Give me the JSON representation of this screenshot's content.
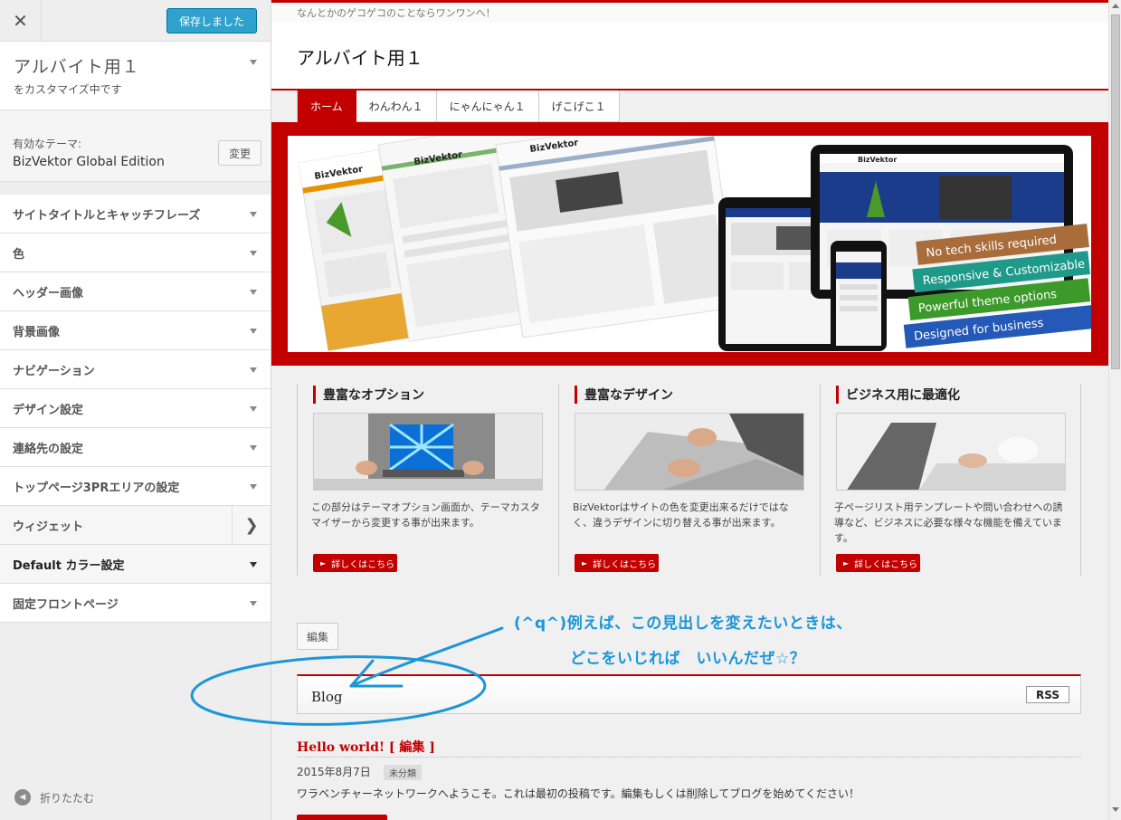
{
  "sidebar": {
    "close_glyph": "✕",
    "save_label": "保存しました",
    "site_title": "アルバイト用１",
    "site_subtitle": "をカスタマイズ中です",
    "theme_label": "有効なテーマ:",
    "theme_name": "BizVektor Global Edition",
    "theme_change": "変更",
    "sections": [
      {
        "label": "サイトタイトルとキャッチフレーズ"
      },
      {
        "label": "色"
      },
      {
        "label": "ヘッダー画像"
      },
      {
        "label": "背景画像"
      },
      {
        "label": "ナビゲーション"
      },
      {
        "label": "デザイン設定"
      },
      {
        "label": "連絡先の設定"
      },
      {
        "label": "トップページ3PRエリアの設定"
      },
      {
        "label": "ウィジェット"
      },
      {
        "label": "Default カラー設定"
      },
      {
        "label": "固定フロントページ"
      }
    ],
    "collapse_label": "折りたたむ"
  },
  "preview": {
    "tagline": "なんとかのゲコゲコのことならワンワンへ！",
    "blog_title": "アルバイト用１",
    "nav": [
      "ホーム",
      "わんわん１",
      "にゃんにゃん１",
      "げこげこ１"
    ],
    "hero": {
      "logo": "BizVektor",
      "banners": [
        "No tech skills required",
        "Responsive & Customizable",
        "Powerful theme options",
        "Designed for business"
      ]
    },
    "pr": [
      {
        "title": "豊富なオプション",
        "text": "この部分はテーマオプション画面か、テーマカスタマイザーから変更する事が出来ます。",
        "button": "詳しくはこちら"
      },
      {
        "title": "豊富なデザイン",
        "text": "BizVektorはサイトの色を変更出来るだけではなく、違うデザインに切り替える事が出来ます。",
        "button": "詳しくはこちら"
      },
      {
        "title": "ビジネス用に最適化",
        "text": "子ページリスト用テンプレートや問い合わせへの誘導など、ビジネスに必要な様々な機能を備えています。",
        "button": "詳しくはこちら"
      }
    ],
    "edit_label": "編集",
    "annotation_line1": "(^q^)例えば、この見出しを変えたいときは、",
    "annotation_line2": "どこをいじれば　いいんだぜ☆？",
    "blog_heading": "Blog",
    "rss_label": "RSS",
    "post": {
      "title": "Hello world! [ 編集 ]",
      "date": "2015年8月7日",
      "category": "未分類",
      "body": "ワラベンチャーネットワークへようこそ。これは最初の投稿です。編集もしくは削除してブログを始めてください！"
    }
  },
  "colors": {
    "accent": "#c30000",
    "save_button": "#2ea2cc",
    "annotation": "#1b96d8"
  }
}
